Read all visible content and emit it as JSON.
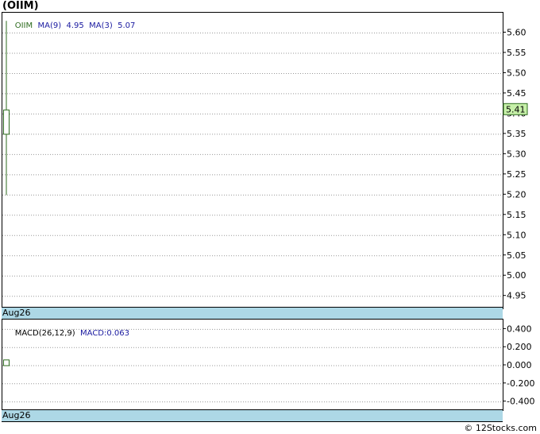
{
  "header": {
    "title": "(OIIM)"
  },
  "colors": {
    "price": "#2d6b1e",
    "ma": "#1a1aa0",
    "date_bar": "#add8e6",
    "last_tag": "#c6f0a8"
  },
  "legend": {
    "symbol": "OIIM",
    "ma9_label": "MA(9)",
    "ma9_value": "4.95",
    "ma3_label": "MA(3)",
    "ma3_value": "5.07"
  },
  "macd_legend": {
    "params": "MACD(26,12,9)",
    "value_label": "MACD:0.063"
  },
  "date_label": "Aug26",
  "footer": "© 12Stocks.com",
  "chart_data": [
    {
      "type": "candlestick",
      "title": "(OIIM)",
      "x": [
        "Aug26"
      ],
      "ylim": [
        4.92,
        5.65
      ],
      "yticks": [
        "5.60",
        "5.55",
        "5.50",
        "5.45",
        "5.40",
        "5.35",
        "5.30",
        "5.25",
        "5.20",
        "5.15",
        "5.10",
        "5.05",
        "5.00",
        "4.95"
      ],
      "last_price": "5.41",
      "grid": true,
      "series": [
        {
          "name": "OIIM",
          "high": 5.63,
          "low": 5.2,
          "open": 5.35,
          "close": 5.41
        }
      ]
    },
    {
      "type": "bar",
      "title": "MACD(26,12,9)",
      "x": [
        "Aug26"
      ],
      "ylim": [
        -0.5,
        0.5
      ],
      "yticks": [
        "0.400",
        "0.200",
        "0.000",
        "-0.200",
        "-0.400"
      ],
      "grid": true,
      "series": [
        {
          "name": "MACD",
          "values": [
            0.063
          ]
        }
      ]
    }
  ]
}
